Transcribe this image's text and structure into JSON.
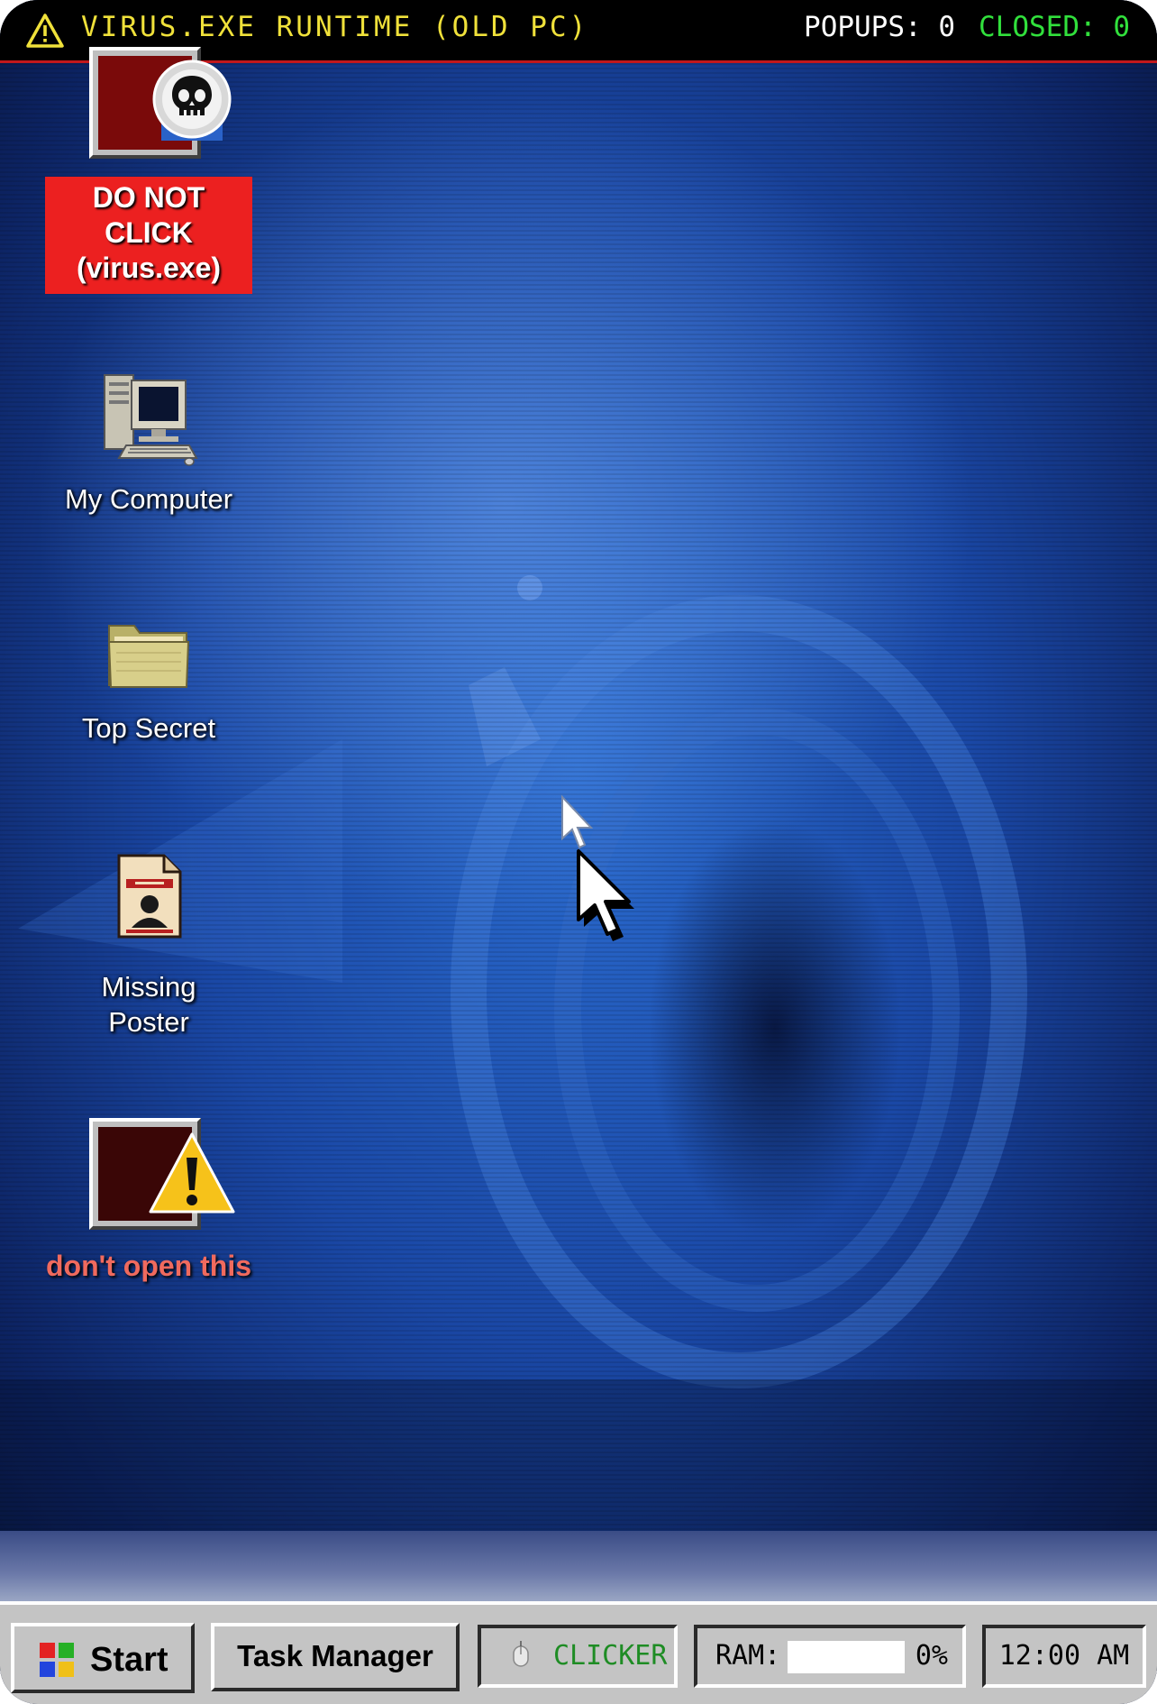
{
  "topbar": {
    "title": "VIRUS.EXE RUNTIME (OLD PC)",
    "popups_label": "POPUPS: 0",
    "closed_label": "CLOSED: 0",
    "warning_color": "#f0e13a"
  },
  "desktop": {
    "icons": [
      {
        "label": "DO NOT CLICK (virus.exe)",
        "icon": "skull-icon"
      },
      {
        "label": "My Computer",
        "icon": "computer-icon"
      },
      {
        "label": "Top Secret",
        "icon": "folder-icon"
      },
      {
        "label": "Missing Poster",
        "icon": "poster-icon"
      },
      {
        "label": "don't open this",
        "icon": "warning-icon"
      }
    ]
  },
  "taskbar": {
    "start_label": "Start",
    "task_manager_label": "Task Manager",
    "clicker_label": "CLICKER",
    "ram_label": "RAM:",
    "ram_percent_text": "0%",
    "ram_fraction": 0,
    "clock": "12:00 AM"
  }
}
